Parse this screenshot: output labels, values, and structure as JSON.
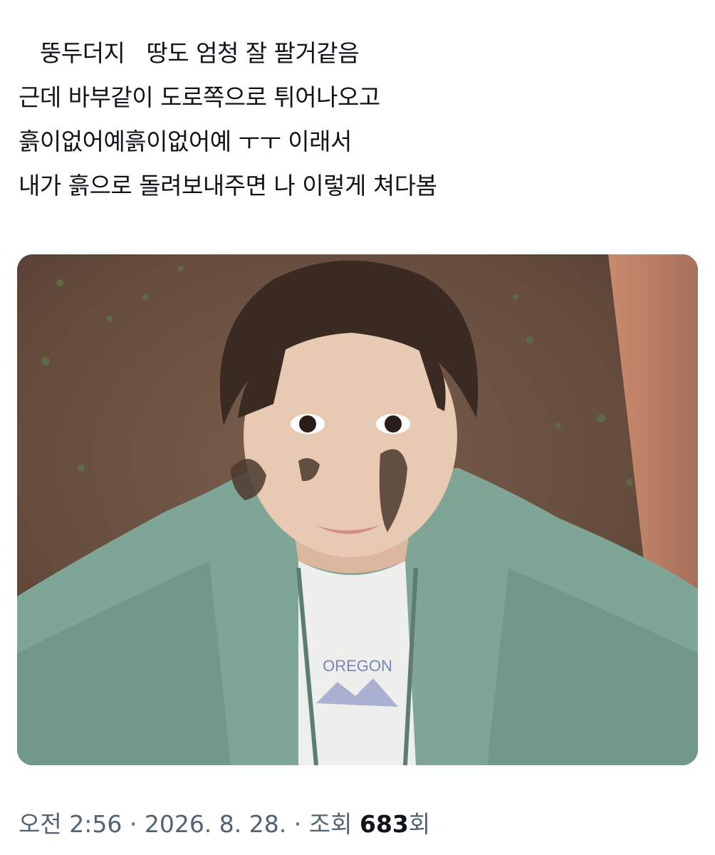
{
  "tweet": {
    "lines": [
      "   뚱두더지   땅도 엄청 잘 팔거같음",
      "근데 바부같이 도로쪽으로 튀어나오고",
      "흙이없어예흙이없어예 ㅜㅜ 이래서",
      "내가 흙으로 돌려보내주면 나 이렇게 쳐다봄"
    ]
  },
  "meta": {
    "time": "오전 2:56",
    "date": "2026. 8. 28.",
    "views_label": "조회",
    "views_count": "683",
    "views_suffix": "회",
    "separator": "·"
  },
  "photo": {
    "shirt_text": "OREGON"
  },
  "colors": {
    "text": "#0f1419",
    "meta": "#536471",
    "ground": "#6b5344",
    "jacket": "#7fa597",
    "hair": "#3a2a22",
    "skin": "#e8c9b2"
  }
}
